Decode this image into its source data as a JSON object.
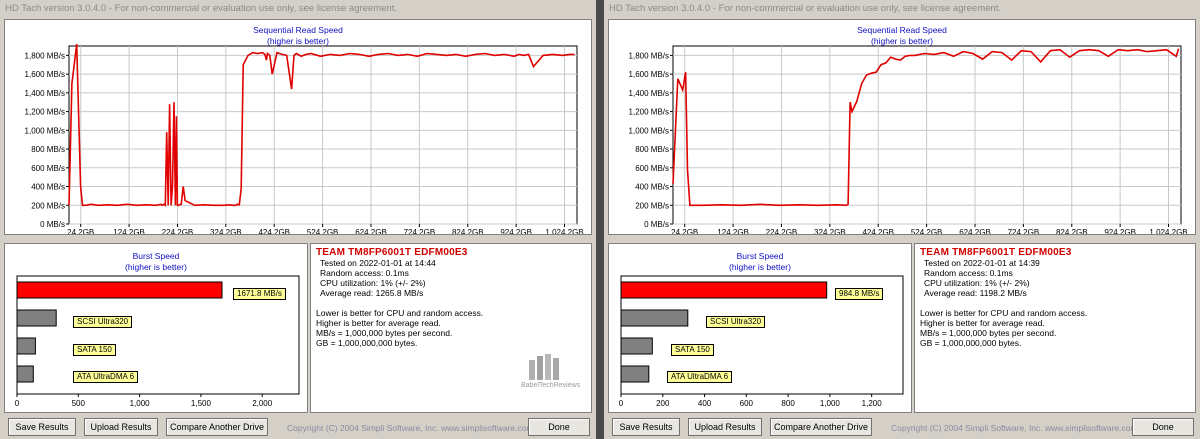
{
  "windows": [
    {
      "title": "HD Tach version 3.0.4.0  - For non-commercial or evaluation use only, see license agreement.",
      "seq_chart": {
        "title": "Sequential Read Speed",
        "subtitle": "(higher is better)",
        "y_ticks": [
          "1,800 MB/s",
          "1,600 MB/s",
          "1,400 MB/s",
          "1,200 MB/s",
          "1,000 MB/s",
          "800 MB/s",
          "600 MB/s",
          "400 MB/s",
          "200 MB/s",
          "0 MB/s"
        ],
        "x_ticks": [
          "24.2GB",
          "124.2GB",
          "224.2GB",
          "324.2GB",
          "424.2GB",
          "524.2GB",
          "624.2GB",
          "724.2GB",
          "824.2GB",
          "924.2GB",
          "1,024.2GB"
        ]
      },
      "burst": {
        "title": "Burst Speed",
        "subtitle": "(higher is better)",
        "bars": [
          {
            "label": "1671.8 MB/s",
            "value": 1671.8
          },
          {
            "label": "SCSI Ultra320",
            "value": 320
          },
          {
            "label": "SATA 150",
            "value": 150
          },
          {
            "label": "ATA UltraDMA 6",
            "value": 133
          }
        ],
        "x_ticks": [
          "0",
          "500",
          "1,000",
          "1,500",
          "2,000"
        ]
      },
      "info": {
        "drive": "TEAM TM8FP6001T EDFM00E3",
        "lines": [
          "Tested on 2022-01-01 at 14:44",
          "Random access: 0.1ms",
          "CPU utilization: 1% (+/- 2%)",
          "Average read: 1265.8 MB/s"
        ],
        "notes": [
          "Lower is better for CPU and random access.",
          "Higher is better for average read.",
          "MB/s = 1,000,000 bytes per second.",
          "GB = 1,000,000,000 bytes."
        ]
      },
      "watermark": "BabelTechReviews",
      "buttons": {
        "save": "Save Results",
        "upload": "Upload Results",
        "compare": "Compare Another Drive",
        "done": "Done"
      },
      "copyright": "Copyright (C) 2004 Simpli Software, Inc. www.simplisoftware.com"
    },
    {
      "title": "HD Tach version 3.0.4.0  - For non-commercial or evaluation use only, see license agreement.",
      "seq_chart": {
        "title": "Sequential Read Speed",
        "subtitle": "(higher is better)",
        "y_ticks": [
          "1,800 MB/s",
          "1,600 MB/s",
          "1,400 MB/s",
          "1,200 MB/s",
          "1,000 MB/s",
          "800 MB/s",
          "600 MB/s",
          "400 MB/s",
          "200 MB/s",
          "0 MB/s"
        ],
        "x_ticks": [
          "24.2GB",
          "124.2GB",
          "224.2GB",
          "324.2GB",
          "424.2GB",
          "524.2GB",
          "624.2GB",
          "724.2GB",
          "824.2GB",
          "924.2GB",
          "1,024.2GB"
        ]
      },
      "burst": {
        "title": "Burst Speed",
        "subtitle": "(higher is better)",
        "bars": [
          {
            "label": "984.8 MB/s",
            "value": 984.8
          },
          {
            "label": "SCSI Ultra320",
            "value": 320
          },
          {
            "label": "SATA 150",
            "value": 150
          },
          {
            "label": "ATA UltraDMA 6",
            "value": 133
          }
        ],
        "x_ticks": [
          "0",
          "200",
          "400",
          "600",
          "800",
          "1,000",
          "1,200"
        ]
      },
      "info": {
        "drive": "TEAM TM8FP6001T EDFM00E3",
        "lines": [
          "Tested on 2022-01-01 at 14:39",
          "Random access: 0.1ms",
          "CPU utilization: 1% (+/- 2%)",
          "Average read: 1198.2 MB/s"
        ],
        "notes": [
          "Lower is better for CPU and random access.",
          "Higher is better for average read.",
          "MB/s = 1,000,000 bytes per second.",
          "GB = 1,000,000,000 bytes."
        ]
      },
      "buttons": {
        "save": "Save Results",
        "upload": "Upload Results",
        "compare": "Compare Another Drive",
        "done": "Done"
      },
      "copyright": "Copyright (C) 2004 Simpli Software, Inc. www.simplisoftware.com"
    }
  ],
  "chart_data": [
    {
      "type": "line",
      "title": "Sequential Read Speed",
      "subtitle": "(higher is better)",
      "x_unit": "GB",
      "y_unit": "MB/s",
      "xlim": [
        0,
        1050
      ],
      "ylim": [
        0,
        1900
      ],
      "grid": true,
      "series": [
        {
          "color": "#e00000",
          "x": [
            0,
            6,
            16,
            24,
            28,
            35,
            45,
            60,
            80,
            100,
            120,
            140,
            160,
            180,
            190,
            193,
            196,
            199,
            202,
            205,
            208,
            211,
            214,
            217,
            220,
            222,
            224,
            226,
            228,
            232,
            236,
            240,
            260,
            280,
            300,
            320,
            330,
            340,
            345,
            348,
            352,
            356,
            360,
            370,
            380,
            390,
            400,
            405,
            408,
            410,
            415,
            420,
            430,
            440,
            450,
            460,
            465,
            470,
            480,
            490,
            500,
            520,
            540,
            560,
            580,
            600,
            620,
            640,
            660,
            680,
            700,
            720,
            740,
            760,
            780,
            800,
            820,
            840,
            860,
            880,
            900,
            920,
            930,
            940,
            950,
            960,
            980,
            1000,
            1020,
            1035,
            1045
          ],
          "y": [
            200,
            1500,
            1920,
            400,
            200,
            200,
            210,
            200,
            205,
            200,
            210,
            200,
            205,
            200,
            210,
            200,
            210,
            200,
            980,
            200,
            1280,
            200,
            400,
            1300,
            200,
            1150,
            200,
            200,
            205,
            210,
            400,
            250,
            200,
            205,
            200,
            200,
            205,
            200,
            200,
            210,
            205,
            380,
            1700,
            1800,
            1830,
            1820,
            1830,
            1810,
            1750,
            1820,
            1800,
            1600,
            1830,
            1810,
            1800,
            1440,
            1800,
            1820,
            1790,
            1810,
            1820,
            1790,
            1810,
            1800,
            1820,
            1810,
            1790,
            1810,
            1820,
            1800,
            1810,
            1790,
            1820,
            1810,
            1800,
            1810,
            1790,
            1810,
            1820,
            1800,
            1810,
            1790,
            1810,
            1800,
            1810,
            1680,
            1800,
            1810,
            1800,
            1810,
            1810
          ]
        }
      ]
    },
    {
      "type": "bar",
      "title": "Burst Speed",
      "subtitle": "(higher is better)",
      "categories": [
        "1671.8 MB/s",
        "SCSI Ultra320",
        "SATA 150",
        "ATA UltraDMA 6"
      ],
      "values": [
        1671.8,
        320,
        150,
        133
      ],
      "xlim": [
        0,
        2300
      ]
    },
    {
      "type": "line",
      "title": "Sequential Read Speed",
      "subtitle": "(higher is better)",
      "x_unit": "GB",
      "y_unit": "MB/s",
      "xlim": [
        0,
        1050
      ],
      "ylim": [
        0,
        1900
      ],
      "grid": true,
      "series": [
        {
          "color": "#e00000",
          "x": [
            0,
            10,
            20,
            26,
            30,
            35,
            40,
            60,
            100,
            140,
            180,
            220,
            260,
            300,
            340,
            358,
            362,
            366,
            370,
            380,
            390,
            400,
            410,
            420,
            430,
            440,
            450,
            460,
            470,
            480,
            490,
            500,
            520,
            540,
            560,
            580,
            600,
            620,
            640,
            660,
            680,
            700,
            720,
            740,
            760,
            780,
            800,
            820,
            840,
            860,
            880,
            900,
            920,
            940,
            960,
            980,
            1000,
            1020,
            1040,
            1045
          ],
          "y": [
            430,
            1550,
            1430,
            1620,
            580,
            200,
            200,
            200,
            205,
            200,
            210,
            200,
            205,
            200,
            205,
            200,
            210,
            1300,
            1200,
            1310,
            1500,
            1590,
            1610,
            1620,
            1700,
            1720,
            1780,
            1760,
            1750,
            1790,
            1800,
            1800,
            1820,
            1810,
            1830,
            1790,
            1840,
            1820,
            1760,
            1840,
            1830,
            1750,
            1850,
            1840,
            1730,
            1850,
            1860,
            1780,
            1850,
            1860,
            1850,
            1790,
            1860,
            1850,
            1860,
            1840,
            1850,
            1860,
            1790,
            1870
          ]
        }
      ]
    },
    {
      "type": "bar",
      "title": "Burst Speed",
      "subtitle": "(higher is better)",
      "categories": [
        "984.8 MB/s",
        "SCSI Ultra320",
        "SATA 150",
        "ATA UltraDMA 6"
      ],
      "values": [
        984.8,
        320,
        150,
        133
      ],
      "xlim": [
        0,
        1350
      ]
    }
  ]
}
